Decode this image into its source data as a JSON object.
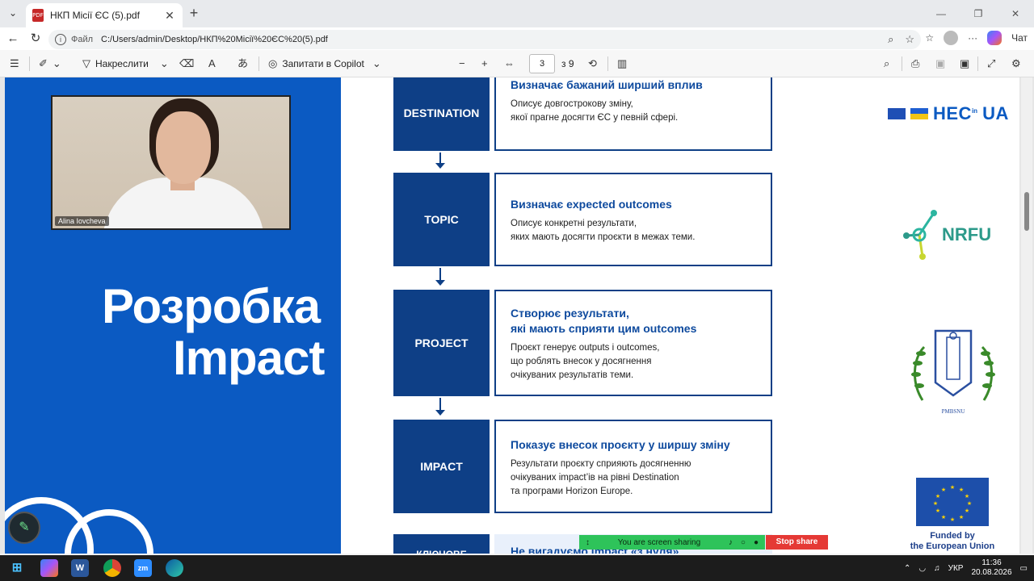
{
  "browser": {
    "tab_title": "НКП Місії ЄС (5).pdf",
    "url_label": "Файл",
    "url": "C:/Users/admin/Desktop/НКП%20Місії%20ЄС%20(5).pdf",
    "chat_label": "Чат"
  },
  "pdf_toolbar": {
    "draw_label": "Накреслити",
    "copilot_label": "Запитати в Copilot",
    "current_page": "3",
    "page_total": "з 9"
  },
  "slide": {
    "title_line1": "Розробка",
    "title_line2": "Impact",
    "participant_name": "Alina Iovcheva",
    "steps": [
      {
        "label": "DESTINATION",
        "heading": "Визначає бажаний ширший вплив",
        "text": "Описує довгострокову зміну,\nякої прагне досягти ЄС у певній сфері."
      },
      {
        "label": "TOPIC",
        "heading": "Визначає expected outcomes",
        "text": "Описує конкретні результати,\nяких мають досягти проєкти в межах теми."
      },
      {
        "label": "PROJECT",
        "heading": "Створює результати,\nякі мають сприяти цим outcomes",
        "text": "Проєкт генерує outputs і outcomes,\nщо роблять внесок у досягнення\nочікуваних результатів теми."
      },
      {
        "label": "IMPACT",
        "heading": "Показує внесок проєкту у ширшу зміну",
        "text": "Результати проєкту сприяють досягненню\nочікуваних impact’ів на рівні Destination\nта програми Horizon Europe."
      }
    ],
    "partial_heading": "Не вигадуємо impact «з нуля»",
    "partial_label": "КЛЮЧОВЕ",
    "logos": {
      "hec": "HEC",
      "hec_small": "in",
      "hec_suffix": "UA",
      "nrfu": "NRFU",
      "knu": "PMBSNU",
      "eu_caption": "Funded by\nthe European Union"
    }
  },
  "screen_share": {
    "status": "You are screen sharing",
    "stop": "Stop share"
  },
  "taskbar": {
    "lang": "УКР",
    "time": "11:36",
    "date": "20.08.2026"
  }
}
